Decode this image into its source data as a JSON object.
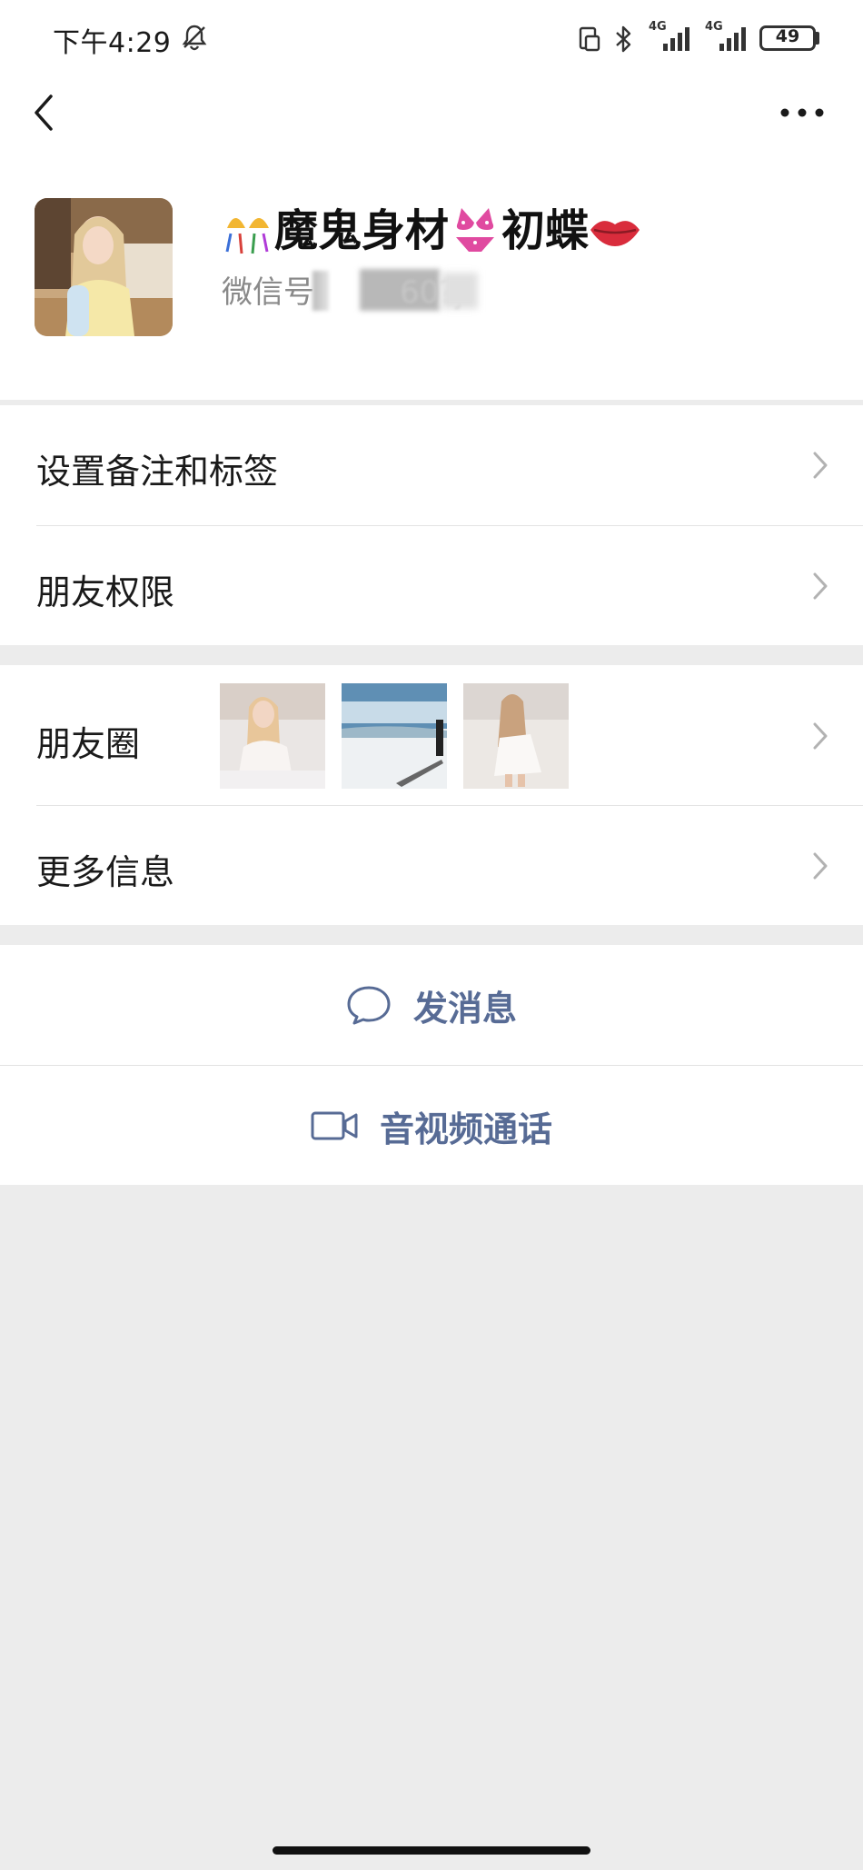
{
  "status_bar": {
    "time": "下午4:29",
    "network_1": "4G",
    "network_2": "4G",
    "battery": "49"
  },
  "nav": {
    "back_icon": "back-chevron-icon",
    "more_icon": "more-dots-icon"
  },
  "profile": {
    "name_segments": [
      "魔鬼身材",
      "初蝶"
    ],
    "name_emojis": [
      "confetti-icon",
      "bikini-icon",
      "lips-kiss-icon"
    ],
    "wechat_id_label": "微信号",
    "wechat_id_partial": "60?ji"
  },
  "menu": {
    "remark_tags": "设置备注和标签",
    "friend_permissions": "朋友权限",
    "moments": "朋友圈",
    "more_info": "更多信息"
  },
  "actions": {
    "send_message": "发消息",
    "video_call": "音视频通话"
  },
  "colors": {
    "link_blue": "#576b95",
    "page_bg": "#ececec",
    "divider": "#e3e3e3"
  }
}
